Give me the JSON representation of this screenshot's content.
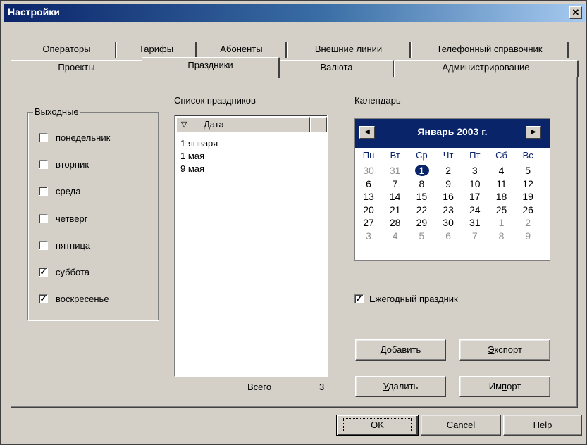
{
  "window": {
    "title": "Настройки",
    "close_symbol": "✕"
  },
  "tabs_row1": [
    {
      "label": "Операторы"
    },
    {
      "label": "Тарифы"
    },
    {
      "label": "Абоненты"
    },
    {
      "label": "Внешние линии"
    },
    {
      "label": "Телефонный справочник"
    }
  ],
  "tabs_row2": [
    {
      "label": "Проекты"
    },
    {
      "label": "Праздники",
      "active": true
    },
    {
      "label": "Валюта"
    },
    {
      "label": "Администрирование"
    }
  ],
  "weekend_group": {
    "label": "Выходные",
    "days": [
      {
        "label": "понедельник",
        "checked": false
      },
      {
        "label": "вторник",
        "checked": false
      },
      {
        "label": "среда",
        "checked": false
      },
      {
        "label": "четверг",
        "checked": false
      },
      {
        "label": "пятница",
        "checked": false
      },
      {
        "label": "суббота",
        "checked": true
      },
      {
        "label": "воскресенье",
        "checked": true
      }
    ],
    "check_mark": "✓"
  },
  "holidays": {
    "label": "Список праздников",
    "column_sort_icon": "▽",
    "column_label": "Дата",
    "items": [
      "1 января",
      "1 мая",
      "9 мая"
    ],
    "total_label": "Всего",
    "total_value": "3"
  },
  "calendar": {
    "label": "Календарь",
    "month_title": "Январь 2003 г.",
    "prev_symbol": "◀",
    "next_symbol": "▶",
    "weekdays": [
      "Пн",
      "Вт",
      "Ср",
      "Чт",
      "Пт",
      "Сб",
      "Вс"
    ],
    "weeks": [
      [
        "30",
        "31",
        "1",
        "2",
        "3",
        "4",
        "5"
      ],
      [
        "6",
        "7",
        "8",
        "9",
        "10",
        "11",
        "12"
      ],
      [
        "13",
        "14",
        "15",
        "16",
        "17",
        "18",
        "19"
      ],
      [
        "20",
        "21",
        "22",
        "23",
        "24",
        "25",
        "26"
      ],
      [
        "27",
        "28",
        "29",
        "30",
        "31",
        "1",
        "2"
      ],
      [
        "3",
        "4",
        "5",
        "6",
        "7",
        "8",
        "9"
      ]
    ],
    "selected_day": "1",
    "header_color": "#0a246a"
  },
  "annual_checkbox": {
    "label": "Ежегодный праздник",
    "checked": true
  },
  "buttons": {
    "add": {
      "accel": "Д",
      "rest": "обавить"
    },
    "export": {
      "accel": "Э",
      "rest": "кспорт"
    },
    "delete": {
      "accel": "У",
      "rest": "далить"
    },
    "import": {
      "pre": "Им",
      "accel": "п",
      "rest": "орт"
    },
    "ok": "OK",
    "cancel": "Cancel",
    "help": "Help"
  }
}
